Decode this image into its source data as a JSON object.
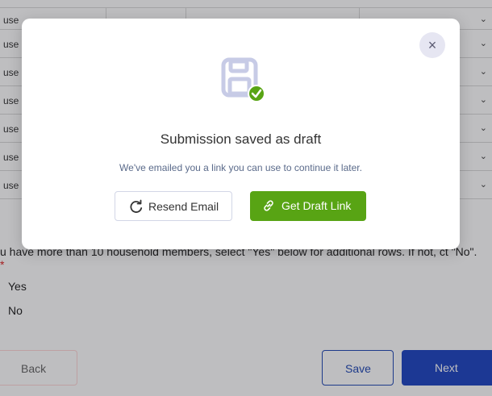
{
  "background": {
    "rows": [
      {
        "cell": "use"
      },
      {
        "cell": "use"
      },
      {
        "cell": "use"
      },
      {
        "cell": "use"
      },
      {
        "cell": "use"
      },
      {
        "cell": "use"
      },
      {
        "cell": "use"
      }
    ],
    "question": "u have more than 10 household members, select \"Yes\" below for additional rows. If not, ct \"No\".",
    "required_mark": "*",
    "radio_yes": "Yes",
    "radio_no": "No",
    "back_label": "Back",
    "save_label": "Save",
    "next_label": "Next"
  },
  "modal": {
    "close_glyph": "×",
    "title": "Submission saved as draft",
    "subtitle": "We've emailed you a link you can use to continue it later.",
    "resend_label": "Resend Email",
    "draft_link_label": "Get Draft Link",
    "icons": {
      "main": "save-draft-icon",
      "check": "check-badge-icon",
      "resend": "refresh-icon",
      "link": "link-icon"
    }
  },
  "colors": {
    "accent_green": "#58a414",
    "primary_blue": "#1f46c2",
    "icon_lavender": "#c7cbe6"
  }
}
